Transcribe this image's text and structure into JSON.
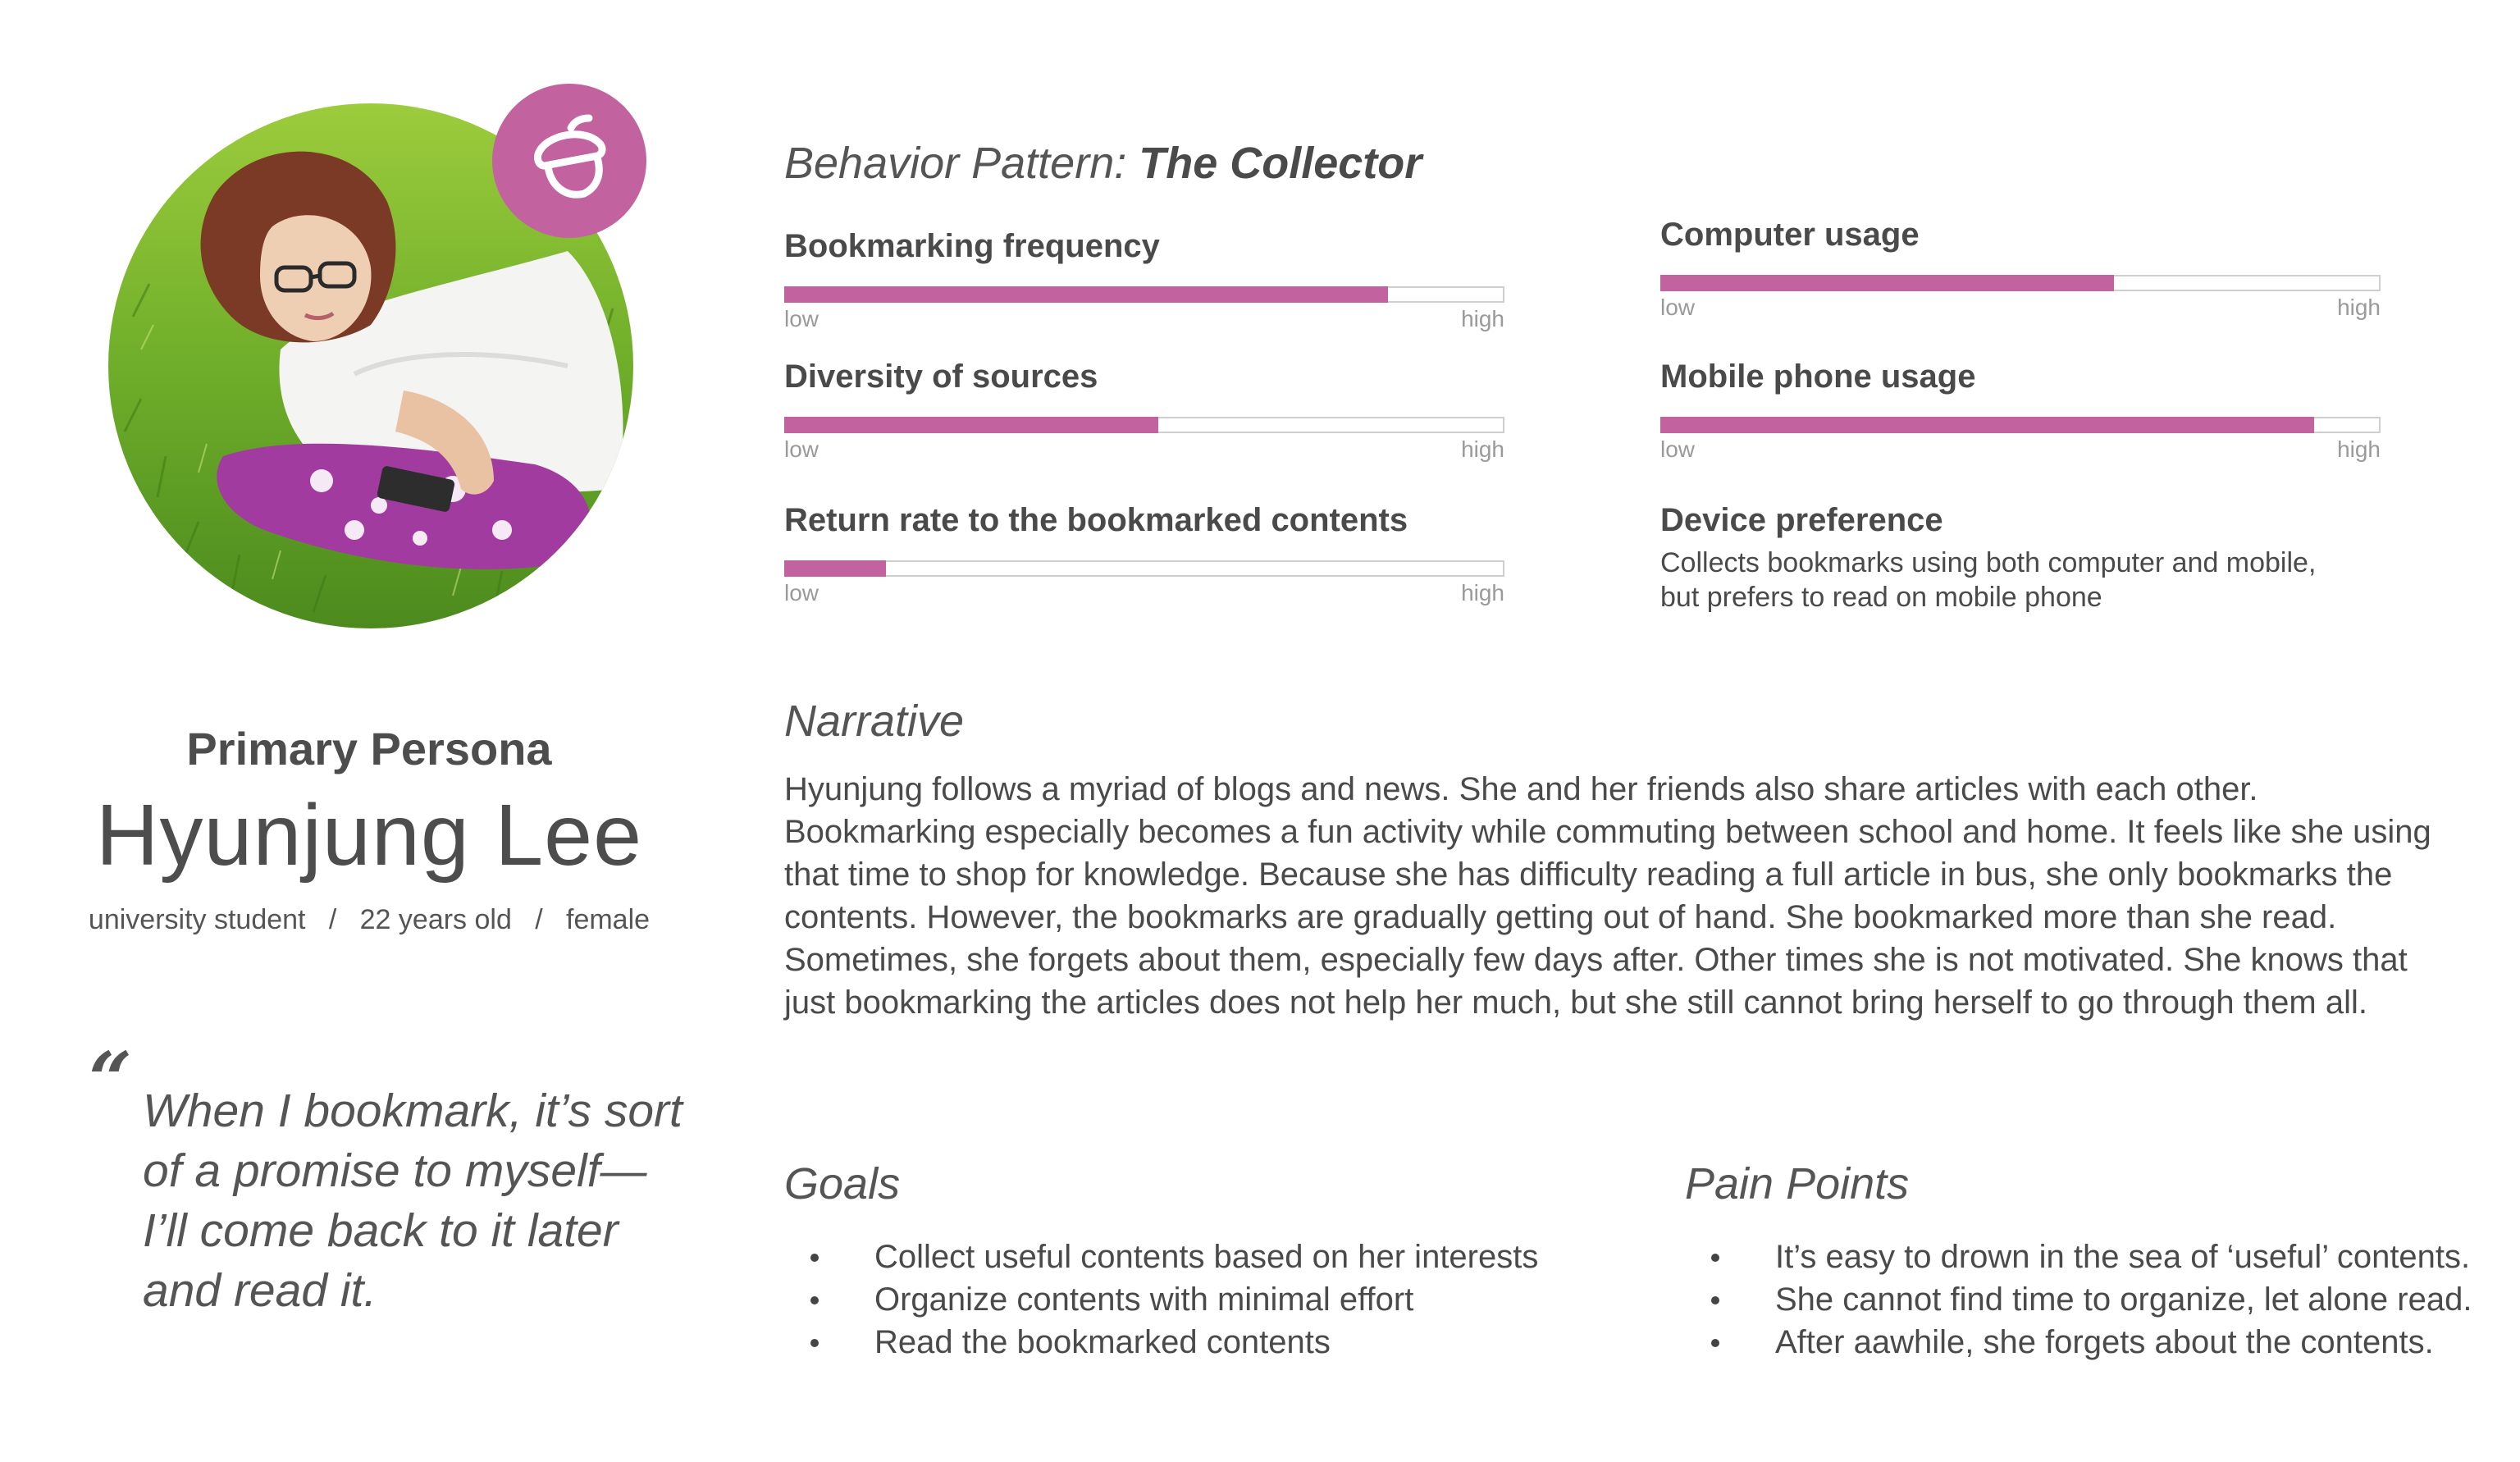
{
  "persona": {
    "label": "Primary Persona",
    "name": "Hyunjung Lee",
    "occupation": "university student",
    "age": "22 years old",
    "gender": "female",
    "photo_icon": "persona-photo",
    "badge_icon": "acorn-icon"
  },
  "quote": {
    "mark": "“",
    "line1": "When I bookmark, it’s sort",
    "line2": "of a promise to myself—",
    "line3": "I’ll come back to it later",
    "line4": "and read it."
  },
  "behavior": {
    "title_prefix": "Behavior Pattern:",
    "title_name": "The Collector",
    "metrics": [
      {
        "label": "Bookmarking frequency",
        "level": 0.84,
        "low": "low",
        "high": "high"
      },
      {
        "label": "Diversity of sources",
        "level": 0.52,
        "low": "low",
        "high": "high"
      },
      {
        "label": "Return rate to the bookmarked contents",
        "level": 0.14,
        "low": "low",
        "high": "high"
      },
      {
        "label": "Computer usage",
        "level": 0.63,
        "low": "low",
        "high": "high"
      },
      {
        "label": "Mobile phone usage",
        "level": 0.91,
        "low": "low",
        "high": "high"
      }
    ],
    "device": {
      "label": "Device preference",
      "line1": "Collects bookmarks using both computer and mobile,",
      "line2": "but prefers to read on mobile phone"
    }
  },
  "narrative": {
    "title": "Narrative",
    "lines": [
      "Hyunjung follows a myriad of blogs and news. She and her friends also share articles with each other.",
      "Bookmarking especially becomes a fun activity while commuting between school and home. It feels like she using",
      "that time to shop for knowledge. Because she has difficulty reading a full article in bus, she only bookmarks the",
      "contents.  However, the bookmarks are gradually getting out of hand. She bookmarked more than she read.",
      "Sometimes, she forgets about them, especially few days after. Other times she is not motivated. She knows that",
      "just bookmarking the articles does not help her much, but she still cannot bring herself to go through them all."
    ]
  },
  "goals": {
    "title": "Goals",
    "items": [
      "Collect useful contents based on her interests",
      "Organize contents with minimal effort",
      "Read the bookmarked contents"
    ]
  },
  "pain_points": {
    "title": "Pain Points",
    "items": [
      "It’s easy to drown in the sea of ‘useful’ contents.",
      "She cannot find time to organize, let alone read.",
      "After aawhile, she forgets about the contents."
    ]
  },
  "colors": {
    "accent": "#c2639f",
    "text": "#4a4a4a",
    "muted": "#9a9a9a",
    "track": "#cfcfcf"
  }
}
